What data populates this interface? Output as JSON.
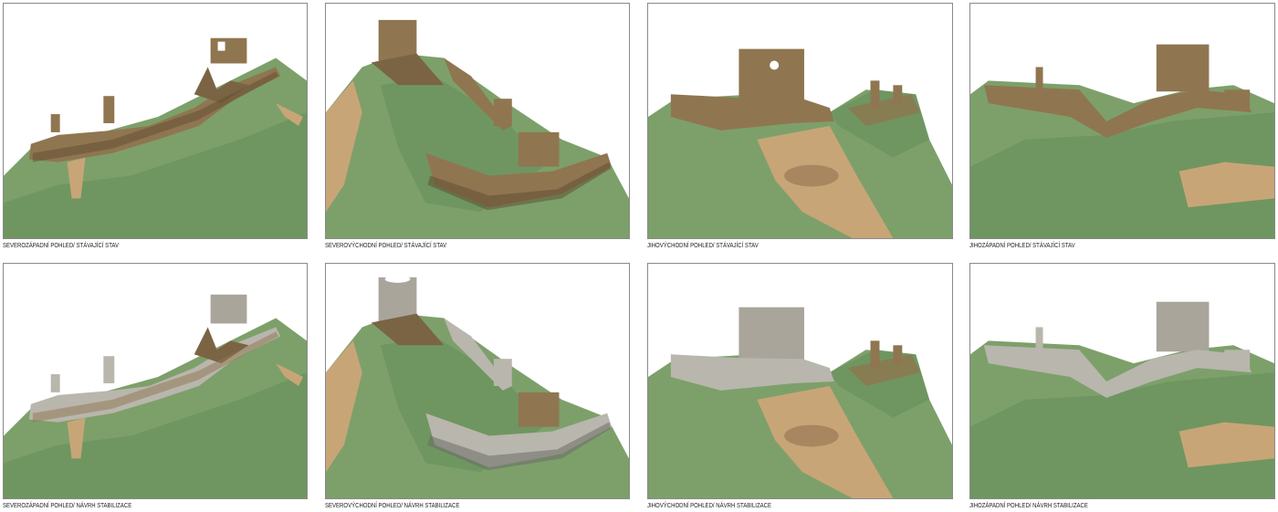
{
  "panels": [
    {
      "caption": "SEVEROZÁPADNÍ POHLED/ STÁVAJÍCÍ STAV",
      "view": "northwest",
      "state": "existing"
    },
    {
      "caption": "SEVEROVÝCHODNÍ POHLED/ STÁVAJÍCÍ STAV",
      "view": "northeast",
      "state": "existing"
    },
    {
      "caption": "JIHOVÝCHODNÍ POHLED/ STÁVAJÍCÍ STAV",
      "view": "southeast",
      "state": "existing"
    },
    {
      "caption": "JIHOZÁPADNÍ POHLED/ STÁVAJÍCÍ STAV",
      "view": "southwest",
      "state": "existing"
    },
    {
      "caption": "SEVEROZÁPADNÍ POHLED/ NÁVRH STABILIZACE",
      "view": "northwest",
      "state": "proposal"
    },
    {
      "caption": "SEVEROVÝCHODNÍ POHLED/ NÁVRH STABILIZACE",
      "view": "northeast",
      "state": "proposal"
    },
    {
      "caption": "JIHOVÝCHODNÍ POHLED/ NÁVRH STABILIZACE",
      "view": "southeast",
      "state": "proposal"
    },
    {
      "caption": "JIHOZÁPADNÍ POHLED/ NÁVRH STABILIZACE",
      "view": "southwest",
      "state": "proposal"
    }
  ],
  "colors": {
    "terrain": "#7da06a",
    "terrain_dark": "#5d7f4e",
    "soil": "#c8a577",
    "ruin": "#8f7650",
    "ruin_dark": "#5e4a2f",
    "stabilized": "#b9b6ad"
  }
}
